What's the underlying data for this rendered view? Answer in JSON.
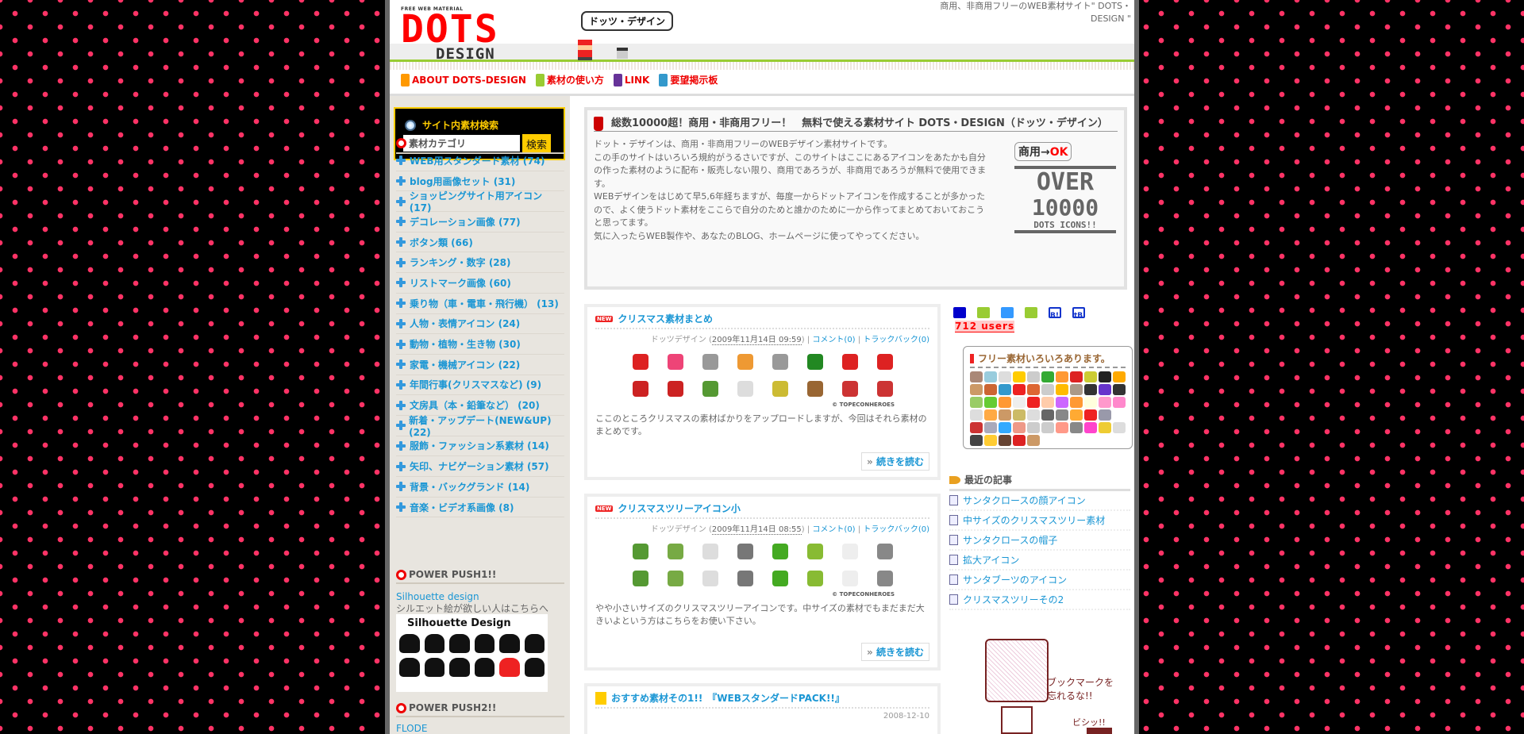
{
  "header": {
    "logo_tag": "FREE WEB MATERIAL",
    "logo_main": "DOTS",
    "logo_sub": "DESIGN",
    "bubble": "ドッツ・デザイン",
    "tagline": "商用、非商用フリーのWEB素材サイト\" DOTS・DESIGN \""
  },
  "nav": [
    {
      "label": "ABOUT DOTS-DESIGN",
      "color": "#f90"
    },
    {
      "label": "素材の使い方",
      "color": "#9c3"
    },
    {
      "label": "LINK",
      "color": "#639"
    },
    {
      "label": "要望掲示板",
      "color": "#39c"
    }
  ],
  "search": {
    "title": "サイト内素材検索",
    "value": "",
    "button": "検索"
  },
  "categories": {
    "title": "素材カテゴリ",
    "items": [
      "WEB用スタンダード素材 (74)",
      "blog用画像セット (31)",
      "ショッピングサイト用アイコン (17)",
      "デコレーション画像 (77)",
      "ボタン類 (66)",
      "ランキング・数字 (28)",
      "リストマーク画像 (60)",
      "乗り物（車・電車・飛行機） (13)",
      "人物・表情アイコン (24)",
      "動物・植物・生き物 (30)",
      "家電・機械アイコン (22)",
      "年間行事(クリスマスなど) (9)",
      "文房具（本・鉛筆など） (20)",
      "新着・アップデート(NEW&UP) (22)",
      "服飾・ファッション系素材 (14)",
      "矢印、ナビゲーション素材 (57)",
      "背景・バックグランド (14)",
      "音楽・ビデオ系画像 (8)"
    ]
  },
  "push1": {
    "title": "POWER PUSH1!!",
    "link": "Silhouette design",
    "desc": "シルエット絵が欲しい人はこちらへ",
    "banner": "Silhouette Design"
  },
  "push2": {
    "title": "POWER PUSH2!!",
    "link": "FLODE"
  },
  "intro": {
    "title": "総数10000超！商用・非商用フリー！　無料で使える素材サイト DOTS・DESIGN（ドッツ・デザイン）",
    "paragraphs": [
      "ドット・デザインは、商用・非商用フリーのWEBデザイン素材サイトです。",
      "この手のサイトはいろいろ規約がうるさいですが、このサイトはここにあるアイコンをあたかも自分の作った素材のように配布・販売しない限り、商用であろうが、非商用であろうが無料で使用できます。",
      "WEBデザインをはじめて早5,6年経ちますが、毎度一からドットアイコンを作成することが多かったので、よく使うドット素材をここらで自分のためと誰かのために一から作ってまとめておいておこうと思ってます。",
      "気に入ったらWEB製作や、あなたのBLOG、ホームページに使ってやってください。"
    ],
    "badge_ok_prefix": "商用→",
    "badge_ok": "OK",
    "badge_over": "OVER",
    "badge_count": "10000",
    "badge_sub": "DOTS ICONS!!"
  },
  "posts": [
    {
      "badge": "NEW",
      "title": "クリスマス素材まとめ",
      "author": "ドッツデザイン",
      "date": "2009年11月14日 09:59",
      "comments": "コメント(0)",
      "trackbacks": "トラックバック(0)",
      "credit": "© TOPECONHEROES",
      "body": "ここのところクリスマスの素材ばかりをアップロードしますが、今回はそれら素材のまとめです。",
      "more": "続きを読む",
      "icons": [
        "#d22",
        "#e47",
        "#999",
        "#e93",
        "#999",
        "#282",
        "#d22",
        "#d22",
        "#c22",
        "#c22",
        "#593",
        "#ddd",
        "#cb3",
        "#963",
        "#c33",
        "#c33"
      ]
    },
    {
      "badge": "NEW",
      "title": "クリスマスツリーアイコン小",
      "author": "ドッツデザイン",
      "date": "2009年11月14日 08:55",
      "comments": "コメント(0)",
      "trackbacks": "トラックバック(0)",
      "credit": "© TOPECONHEROES",
      "body": "やや小さいサイズのクリスマスツリーアイコンです。中サイズの素材でもまだまだ大きいよという方はこちらをお使い下さい。",
      "more": "続きを読む",
      "icons": [
        "#593",
        "#7a4",
        "#ddd",
        "#777",
        "#4a2",
        "#8b3",
        "#eee",
        "#888",
        "#593",
        "#7a4",
        "#ddd",
        "#777",
        "#4a2",
        "#8b3",
        "#eee",
        "#888"
      ]
    },
    {
      "title": "おすすめ素材その1!!　『WEBスタンダードPACK!!』",
      "date": "2008-12-10"
    }
  ],
  "social": {
    "users": "712 users",
    "icons": [
      "#00c",
      "#9c3",
      "#39f",
      "#9c3",
      "#13c",
      "#13c"
    ],
    "icon_labels": [
      "B!",
      "tB"
    ]
  },
  "free": {
    "title": "フリー素材いろいろあります。",
    "colors": [
      "#a87",
      "#9cd",
      "#ddd",
      "#fc0",
      "#ccc",
      "#3a3",
      "#f93",
      "#d22",
      "#cc3",
      "#222",
      "#fa0",
      "#c96",
      "#c63",
      "#39c",
      "#e22",
      "#d63",
      "#ccc",
      "#fb0",
      "#a98",
      "#333",
      "#63c",
      "#333",
      "#9c6",
      "#6c3",
      "#f93",
      "#eee",
      "#e22",
      "#fca",
      "#c6f",
      "#f93",
      "#ffd",
      "#f9c",
      "#f8c",
      "#ddd",
      "#fa4",
      "#c96",
      "#cb6",
      "#ddd",
      "#666",
      "#888",
      "#fa3",
      "#e22",
      "#99a",
      "#fff",
      "#c33",
      "#aab",
      "#3af",
      "#e98",
      "#ccc",
      "#ccc",
      "#f98",
      "#888",
      "#f4c",
      "#ec3",
      "#ddd",
      "#444",
      "#fc3",
      "#643",
      "#d22",
      "#c96"
    ]
  },
  "recent": {
    "title": "最近の記事",
    "items": [
      "サンタクロースの顔アイコン",
      "中サイズのクリスマスツリー素材",
      "サンタクロースの帽子",
      "拡大アイコン",
      "サンタブーツのアイコン",
      "クリスマスツリーその2"
    ]
  },
  "mascot": {
    "line1": "ブックマークを",
    "line2": "忘れるな!!",
    "sfx": "ビシッ!!"
  }
}
